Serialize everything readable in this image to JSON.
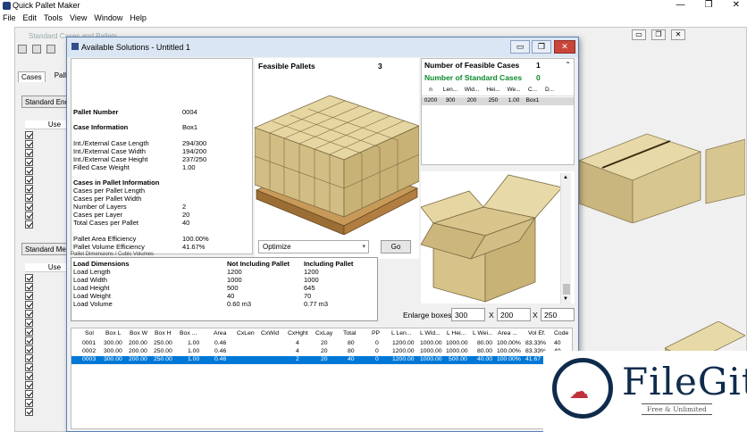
{
  "app": {
    "title": "Quick Pallet Maker",
    "menu": [
      "File",
      "Edit",
      "Tools",
      "View",
      "Window",
      "Help"
    ],
    "window_controls": [
      "—",
      "❐",
      "✕"
    ]
  },
  "background": {
    "title": "Standard Cases and Pallets",
    "tabs": [
      "Cases",
      "Palle"
    ],
    "standard_ends": "Standard Ends",
    "standard_me": "Standard Me",
    "use_header": "Use",
    "win_controls": [
      "▭",
      "❐",
      "✕"
    ]
  },
  "dialog": {
    "title": "Available Solutions - Untitled 1",
    "controls": [
      "▭",
      "❐",
      "✕"
    ],
    "info": {
      "pallet_number_label": "Pallet Number",
      "pallet_number": "0004",
      "case_info_label": "Case Information",
      "case_info": "Box1",
      "rows": [
        {
          "label": "Int./External Case Length",
          "value": "294/300"
        },
        {
          "label": "Int./External Case Width",
          "value": "194/200"
        },
        {
          "label": "Int./External Case Height",
          "value": "237/250"
        },
        {
          "label": "Filled Case Weight",
          "value": "1.00"
        }
      ],
      "cases_in_pallet_label": "Cases in Pallet Information",
      "pallet_rows": [
        {
          "label": "Cases per Pallet Length",
          "value": ""
        },
        {
          "label": "Cases per Pallet Width",
          "value": ""
        },
        {
          "label": "Number of Layers",
          "value": "2"
        },
        {
          "label": "Cases per Layer",
          "value": "20"
        },
        {
          "label": "Total Cases per Pallet",
          "value": "40"
        }
      ],
      "eff_rows": [
        {
          "label": "Pallet Area Efficiency",
          "value": "100.00%"
        },
        {
          "label": "Pallet Volume Efficiency",
          "value": "41.67%"
        }
      ]
    },
    "feasible": {
      "label": "Feasible Pallets",
      "count": "3"
    },
    "right": {
      "nf_label": "Number of Feasible Cases",
      "nf_value": "1",
      "ns_label": "Number of Standard Cases",
      "ns_value": "0",
      "columns": [
        "n",
        "Len...",
        "Wid...",
        "Hei...",
        "We...",
        "C...",
        "D..."
      ],
      "row": [
        "0200",
        "300",
        "200",
        "250",
        "1.00",
        "Box1",
        ""
      ]
    },
    "optimize": {
      "value": "Optimize",
      "go": "Go"
    },
    "load": {
      "caption": "Pallet Dimensions / Cubic Volumes",
      "header": [
        "Load Dimensions",
        "Not Including Pallet",
        "Including Pallet"
      ],
      "rows": [
        [
          "Load Length",
          "1200",
          "1200"
        ],
        [
          "Load Width",
          "1000",
          "1000"
        ],
        [
          "Load Height",
          "500",
          "645"
        ],
        [
          "Load Weight",
          "40",
          "70"
        ],
        [
          "Load Volume",
          "0.60 m3",
          "0.77 m3"
        ]
      ]
    },
    "enlarge": {
      "label": "Enlarge boxes",
      "values": [
        "300",
        "200",
        "250"
      ],
      "x": "X"
    },
    "solutions": {
      "columns": [
        "Sol",
        "Box L",
        "Box W",
        "Box H",
        "Box ...",
        "Area",
        "CxLen",
        "CxWid",
        "CxHght",
        "CxLay",
        "Total",
        "PP",
        "L Len...",
        "L Wid...",
        "L Hei...",
        "L Wei...",
        "Area ...",
        "Vol Ef.",
        "Code"
      ],
      "rows": [
        [
          "0001",
          "300.00",
          "200.00",
          "250.00",
          "1.00",
          "0.46",
          "",
          "",
          "4",
          "20",
          "80",
          "0",
          "1200.00",
          "1000.00",
          "1000.00",
          "80.00",
          "100.00%",
          "83.33%",
          "40"
        ],
        [
          "0002",
          "300.00",
          "200.00",
          "250.00",
          "1.00",
          "0.46",
          "",
          "",
          "4",
          "20",
          "80",
          "0",
          "1200.00",
          "1000.00",
          "1000.00",
          "80.00",
          "100.00%",
          "83.33%",
          "40"
        ],
        [
          "0003",
          "300.00",
          "200.00",
          "250.00",
          "1.00",
          "0.46",
          "",
          "",
          "2",
          "20",
          "40",
          "0",
          "1200.00",
          "1000.00",
          "500.00",
          "40.00",
          "100.00%",
          "41.67",
          "40"
        ]
      ],
      "selected_index": 2
    }
  },
  "watermark": {
    "name": "FileGit",
    "tagline": "Free & Unlimited"
  },
  "colors": {
    "selection": "#0078d7",
    "standard_green": "#0a8a2a",
    "box_tan": "#d9c99a",
    "pallet_wood": "#b88a4a",
    "brand_navy": "#0f2b4c",
    "brand_red": "#c0313a"
  }
}
